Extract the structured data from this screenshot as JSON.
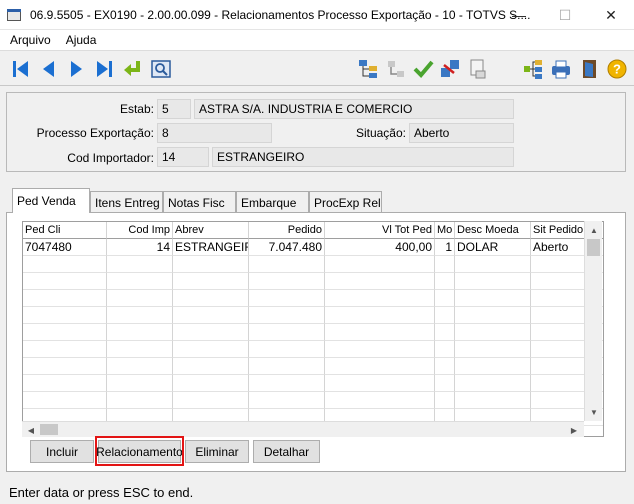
{
  "window": {
    "title": "06.9.5505 - EX0190 - 2.00.00.099 - Relacionamentos Processo Exportação - 10 - TOTVS S....",
    "min_icon": "—",
    "max_icon": "☐",
    "close_icon": "✕"
  },
  "menu": {
    "items": [
      "Arquivo",
      "Ajuda"
    ]
  },
  "toolbar": {
    "icons": [
      "first-icon",
      "prev-icon",
      "next-icon",
      "last-icon",
      "goto-icon",
      "search-icon",
      "tree-icon",
      "sequence-icon",
      "check-icon",
      "transfer-icon",
      "document-icon",
      "relation-icon",
      "print-icon",
      "exit-icon",
      "help-icon"
    ],
    "help_glyph": "?"
  },
  "header": {
    "estab_label": "Estab:",
    "estab_code": "5",
    "estab_name": "ASTRA S/A. INDUSTRIA E COMERCIO",
    "processo_label": "Processo Exportação:",
    "processo_value": "8",
    "situacao_label": "Situação:",
    "situacao_value": "Aberto",
    "importador_label": "Cod Importador:",
    "importador_code": "14",
    "importador_name": "ESTRANGEIRO"
  },
  "tabs": [
    "Ped Venda",
    "Itens Entreg",
    "Notas Fisc",
    "Embarque",
    "ProcExp Rel"
  ],
  "active_tab": "Ped Venda",
  "grid": {
    "columns": [
      "Ped Cli",
      "Cod Imp",
      "Abrev",
      "Pedido",
      "Vl Tot Ped",
      "Mo",
      "Desc Moeda",
      "Sit Pedido"
    ],
    "rows": [
      [
        "7047480",
        "14",
        "ESTRANGEIRO",
        "7.047.480",
        "400,00",
        "1",
        "DOLAR",
        "Aberto"
      ]
    ]
  },
  "scroll": {
    "up": "▲",
    "down": "▼",
    "left": "◀",
    "right": "▶"
  },
  "buttons": {
    "incluir": "Incluir",
    "relacionamento": "Relacionamento",
    "eliminar": "Eliminar",
    "detalhar": "Detalhar"
  },
  "status": {
    "text": "Enter data or press ESC to end."
  }
}
